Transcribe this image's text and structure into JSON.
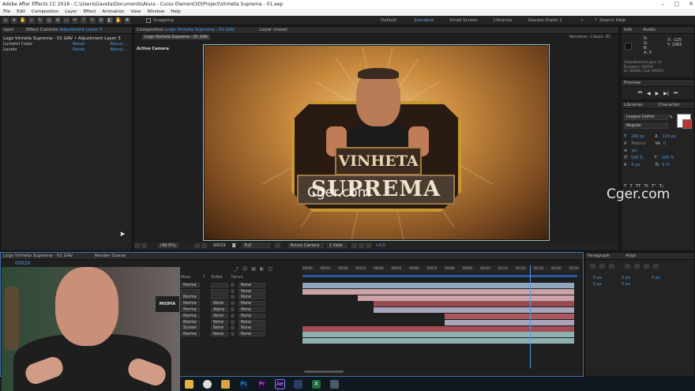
{
  "window": {
    "title": "Adobe After Effects CC 2018 - C:\\Users\\Gaveta\\Documents\\Alura - Curso Element3D\\Project\\Vinheta Suprema - 01.aep",
    "controls": [
      "–",
      "□",
      "✕"
    ]
  },
  "menu": [
    "File",
    "Edit",
    "Composition",
    "Layer",
    "Effect",
    "Animation",
    "View",
    "Window",
    "Help"
  ],
  "toolbar": {
    "snapping": "Snapping",
    "workspaces": [
      "Default",
      "Standard",
      "Small Screen",
      "Libraries",
      "Gaveta Duplo 1"
    ],
    "active_workspace": "Standard",
    "search_help": "Search Help"
  },
  "project_panel": {
    "tab": "oject"
  },
  "effect_controls": {
    "tab_label": "Effect Controls",
    "tab_layer": "Adjustment Layer 3",
    "header": "Logo Vinheta Suprema - 01 GAV • Adjustment Layer 3",
    "effects": [
      {
        "name": "Lumetri Color",
        "reset": "Reset",
        "about": "About..."
      },
      {
        "name": "Levels",
        "reset": "Reset",
        "about": "About..."
      }
    ]
  },
  "composition": {
    "tab_label": "Composition",
    "tab_comp": "Logo Vinheta Suprema - 01 GAV",
    "layer_tab": "Layer (none)",
    "sub_tab": "Logo Vinheta Suprema - 01 GAV",
    "renderer_label": "Renderer:",
    "renderer": "Classic 3D",
    "active_camera_label": "Active Camera",
    "artwork": {
      "word1": "VINHETA",
      "word2": "SUPREMA"
    },
    "footer": {
      "zoom": "(49.4%)",
      "timecode": "00029",
      "resolution": "Full",
      "camera": "Active Camera",
      "views": "1 View",
      "exposure": "+0.0"
    }
  },
  "watermarks": [
    "Cger.com",
    "Cger.com"
  ],
  "info_panel": {
    "tabs": [
      "Info",
      "Audio"
    ],
    "rgba": [
      "R:",
      "G:",
      "B:",
      "A: 0"
    ],
    "xy": [
      "X: -125",
      "Y: 1065"
    ],
    "layer_info": "[Adjustment Layer 3]",
    "duration": "Duration: 00054",
    "in_out": "In: 00000, Out: 00053"
  },
  "preview_panel": {
    "tab": "Preview"
  },
  "character_panel": {
    "tabs": [
      "Libraries",
      "Character"
    ],
    "font": "League Gothic",
    "style": "Regular",
    "size": "240 px",
    "leading": "120 px",
    "kerning": "Metrics",
    "tracking": "0",
    "unit": "px",
    "vscale": "100 %",
    "hscale": "100 %",
    "baseline": "0 px",
    "tsume": "0 %"
  },
  "paragraph_panel": {
    "tabs": [
      "Paragraph",
      "Align"
    ],
    "indents": [
      "0 px",
      "0 px",
      "0 px",
      "0 px",
      "0 px"
    ]
  },
  "timeline": {
    "tab": "Logo Vinheta Suprema - 01 GAV",
    "render_tab": "Render Queue",
    "timecode": "00029",
    "columns": [
      "Mode",
      "T",
      "TrkMat",
      "Parent"
    ],
    "ruler": [
      "00000",
      "00010",
      "00020",
      "00030",
      "00040",
      "00050",
      "00060",
      "00070",
      "00080",
      "00090",
      "00100",
      "00110",
      "00120",
      "00130",
      "00140",
      "00150"
    ],
    "layers": [
      {
        "mode": "Norma",
        "trkmat": "",
        "parent": "None"
      },
      {
        "mode": "",
        "trkmat": "",
        "parent": "None"
      },
      {
        "mode": "Norma",
        "trkmat": "",
        "parent": "None"
      },
      {
        "mode": "Norma",
        "trkmat": "None",
        "parent": "None"
      },
      {
        "mode": "Norma",
        "trkmat": "Alpha",
        "parent": "None"
      },
      {
        "mode": "Norma",
        "trkmat": "None",
        "parent": "None"
      },
      {
        "mode": "Norma",
        "trkmat": "None",
        "parent": "None"
      },
      {
        "mode": "Screen",
        "trkmat": "None",
        "parent": "None"
      },
      {
        "mode": "Norma",
        "trkmat": "None",
        "parent": "None"
      }
    ],
    "bar_colors": [
      "#8fa7bf",
      "#c9a3a6",
      "#c9a3a6",
      "#9a4a52",
      "#a8a3b8",
      "#a9585e",
      "#a8a3b8",
      "#a34a52",
      "#8fb0b0",
      "#8fb0b0"
    ]
  },
  "webcam_poster": "MIOPIA",
  "taskbar": [
    "folder-icon",
    "chrome-icon",
    "edge-icon",
    "photoshop-icon",
    "premiere-icon",
    "aftereffects-icon",
    "shield-icon",
    "excel-icon",
    "explorer-icon"
  ],
  "taskbar_labels": [
    "Ps",
    "Pr",
    "Ae",
    "X"
  ]
}
